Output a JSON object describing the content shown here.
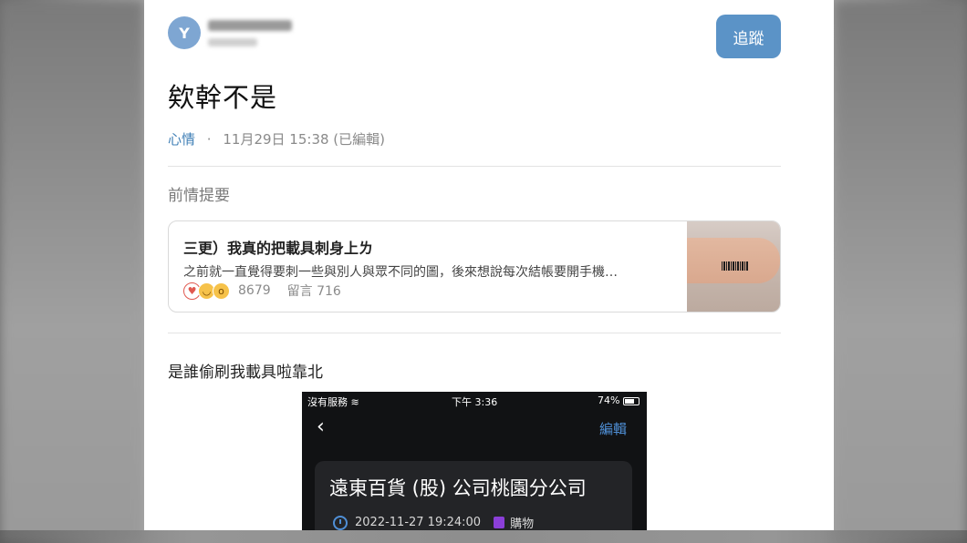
{
  "post": {
    "follow_label": "追蹤",
    "title": "欸幹不是",
    "board": "心情",
    "meta_separator": "·",
    "timestamp": "11月29日 15:38 (已編輯)"
  },
  "previous": {
    "section_label": "前情提要",
    "card": {
      "title": "三更）我真的把載具刺身上ㄌ",
      "excerpt": "之前就一直覺得要刺一些與別人與眾不同的圖，後來想說每次結帳要開手機…",
      "reaction_count": "8679",
      "comments": "留言 716"
    }
  },
  "body": {
    "text": "是誰偷刷我載具啦靠北"
  },
  "screenshot": {
    "status_left": "沒有服務",
    "status_time": "下午 3:36",
    "status_right": "74%",
    "edit_label": "編輯",
    "store_name": "遠東百貨 (股) 公司桃園分公司",
    "datetime": "2022-11-27 19:24:00",
    "category": "購物"
  },
  "colors": {
    "accent": "#5b93c7",
    "link": "#3f7fb6",
    "card_border": "#d9d9d9",
    "phone_bg": "#111214"
  },
  "icons": [
    "avatar-y-icon",
    "heart-icon",
    "laugh-icon",
    "wow-icon",
    "wifi-icon",
    "battery-icon",
    "back-chevron-icon",
    "clock-icon",
    "shopping-bag-icon"
  ]
}
